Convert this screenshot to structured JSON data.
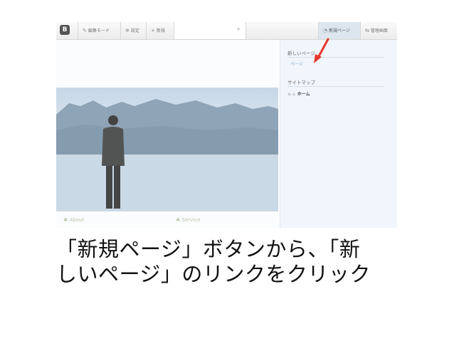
{
  "toolbar": {
    "logo": "B",
    "items": [
      {
        "icon": "pencil-icon",
        "label": "編集モード"
      },
      {
        "icon": "gear-icon",
        "label": "設定"
      },
      {
        "icon": "plus-icon",
        "label": "新規"
      }
    ],
    "search_icon": "search-icon",
    "right_items": [
      {
        "icon": "new-page-icon",
        "label": "新規ページ"
      },
      {
        "icon": "admin-icon",
        "label": "管理画面"
      }
    ]
  },
  "main": {
    "sections": [
      "About",
      "Service"
    ]
  },
  "sidebar": {
    "new_page_heading": "新しいページ",
    "new_page_link": "ページ",
    "sitemap_heading": "サイトマップ",
    "home_label": "ホーム"
  },
  "caption": {
    "line1": "「新規ページ」ボタンから、「新",
    "line2": "しいページ」のリンクをクリック"
  },
  "colors": {
    "accent_arrow": "#e8372c",
    "sidebar_bg": "#f1f6fc",
    "link": "#7aa4cf"
  }
}
